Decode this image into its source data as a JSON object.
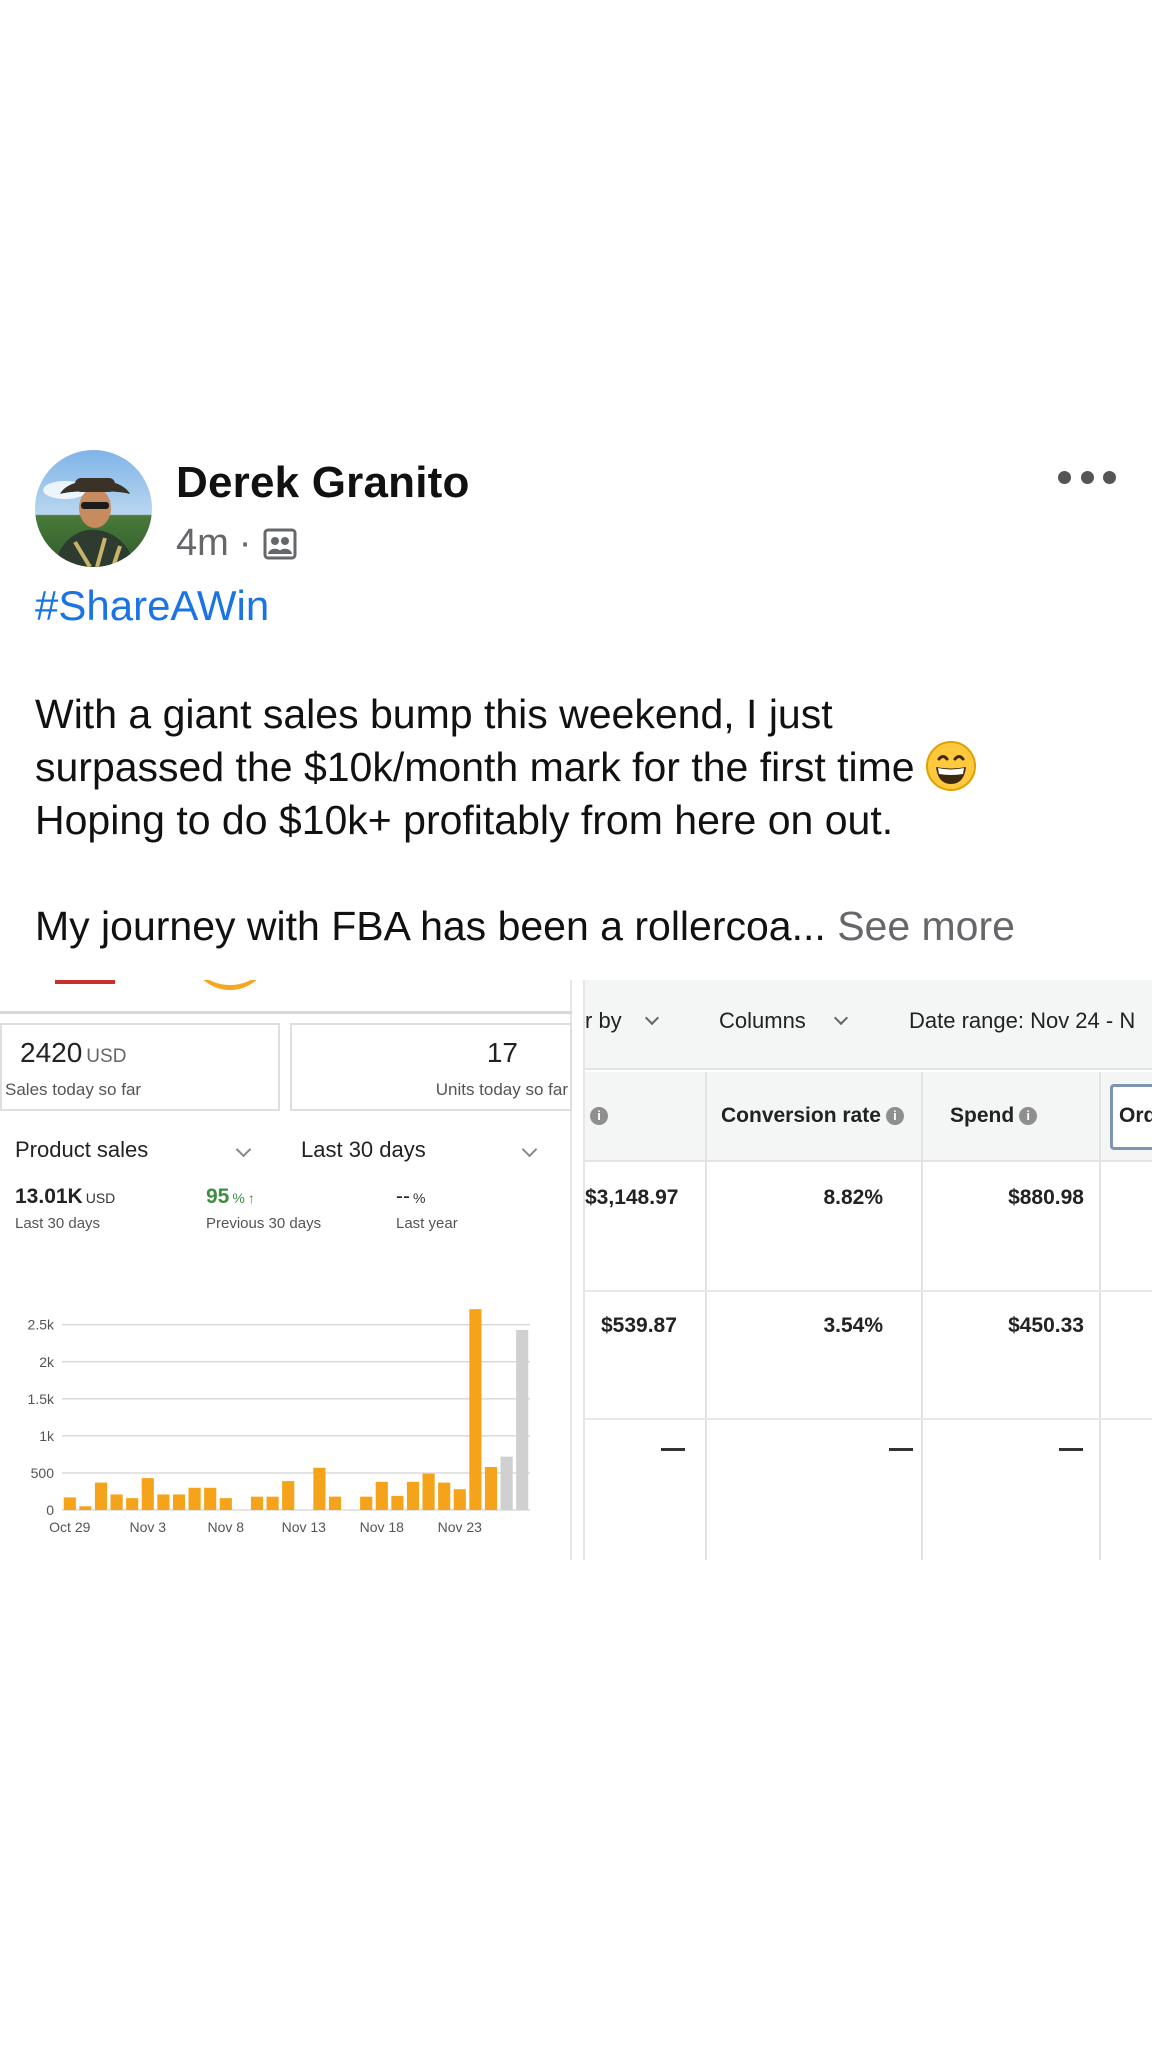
{
  "post": {
    "author": "Derek Granito",
    "time": "4m",
    "separator": "·",
    "audience_icon": "group-icon",
    "more_icon": "more-dots-icon",
    "hashtag": "#ShareAWin",
    "text_lines": [
      "With a giant sales bump this weekend, I just",
      "surpassed the $10k/month mark for the first time",
      "Hoping to do $10k+ profitably from here on out."
    ],
    "emoji": "grinning-face-emoji",
    "journey_text": "My journey with FBA has been a rollercoa...",
    "see_more": "See more"
  },
  "dashboard": {
    "sales_today": {
      "value": "2420",
      "unit": "USD",
      "label": "Sales today so far"
    },
    "units_today": {
      "value": "17",
      "label": "Units today so far"
    },
    "metric_dropdown": "Product sales",
    "range_dropdown": "Last 30 days",
    "stats": [
      {
        "value": "13.01K",
        "unit": "USD",
        "label": "Last 30 days"
      },
      {
        "value": "95",
        "unit": "%",
        "arrow": "↑",
        "label": "Previous 30 days"
      },
      {
        "value": "--",
        "unit": "%",
        "label": "Last year"
      }
    ]
  },
  "chart_data": {
    "type": "bar",
    "y_ticks": [
      "0",
      "500",
      "1k",
      "1.5k",
      "2k",
      "2.5k"
    ],
    "ylim": [
      0,
      2500
    ],
    "x_tick_labels": [
      "Oct 29",
      "Nov 3",
      "Nov 8",
      "Nov 13",
      "Nov 18",
      "Nov 23"
    ],
    "series": [
      {
        "color": "#f5a31a",
        "values": [
          170,
          50,
          370,
          210,
          160,
          430,
          210,
          210,
          300,
          300,
          160,
          0,
          180,
          180,
          390,
          0,
          570,
          180,
          0,
          180,
          380,
          190,
          380,
          490,
          370,
          280,
          2710,
          580
        ]
      },
      {
        "color": "#d0d0d0",
        "values": [
          720,
          2430
        ]
      }
    ]
  },
  "table": {
    "toolbar": [
      "r by",
      "Columns",
      "Date range: Nov 24 - N"
    ],
    "headers": [
      "",
      "Conversion rate",
      "Spend",
      "Ord"
    ],
    "rows": [
      [
        "$3,148.97",
        "8.82%",
        "$880.98"
      ],
      [
        "$539.87",
        "3.54%",
        "$450.33"
      ],
      [
        "—",
        "—",
        "—"
      ]
    ]
  }
}
